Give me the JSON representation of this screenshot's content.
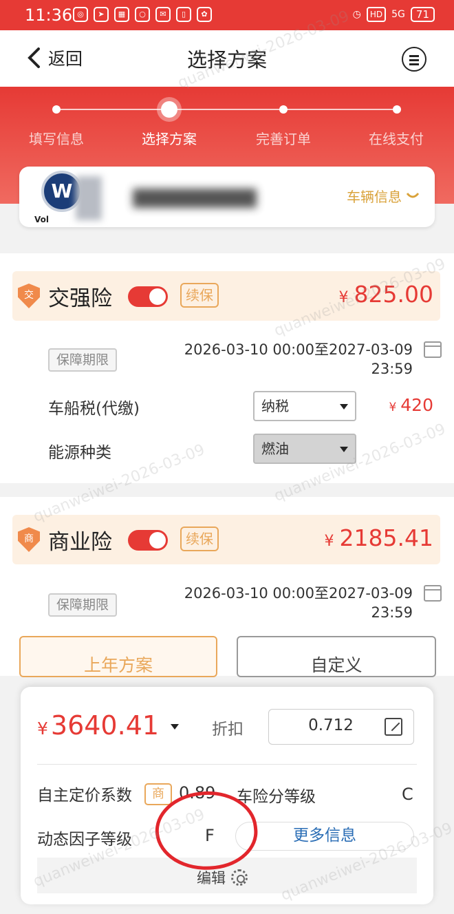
{
  "status_bar": {
    "time": "11:36",
    "network": "5G",
    "battery": "71",
    "hd": "HD",
    "app_icons": [
      "chat-icon",
      "send-icon",
      "app-icon",
      "message-icon",
      "mail-icon",
      "book-icon",
      "shop-icon"
    ]
  },
  "header": {
    "back_label": "返回",
    "title": "选择方案"
  },
  "steps": [
    {
      "label": "填写信息",
      "active": false
    },
    {
      "label": "选择方案",
      "active": true
    },
    {
      "label": "完善订单",
      "active": false
    },
    {
      "label": "在线支付",
      "active": false
    }
  ],
  "vehicle": {
    "brand_text": "Vol",
    "info_label": "车辆信息"
  },
  "compulsory": {
    "title": "交强险",
    "badge": "交",
    "renew_label": "续保",
    "price_currency": "¥",
    "price": "825.00",
    "period_tag": "保障期限",
    "period_line1": "2026-03-10 00:00至2027-03-09",
    "period_line2": "23:59",
    "tax_label": "车船税(代缴)",
    "tax_option": "纳税",
    "tax_currency": "¥",
    "tax_value": "420",
    "energy_label": "能源种类",
    "energy_option": "燃油",
    "toggle_on": true
  },
  "commercial": {
    "title": "商业险",
    "badge": "商",
    "renew_label": "续保",
    "price_currency": "¥",
    "price": "2185.41",
    "period_tag": "保障期限",
    "period_line1": "2026-03-10 00:00至2027-03-09",
    "period_line2": "23:59",
    "toggle_on": true
  },
  "plan_tabs": {
    "last_year": "上年方案",
    "custom": "自定义"
  },
  "summary": {
    "total_currency": "¥",
    "total": "3640.41",
    "discount_label": "折扣",
    "discount_value": "0.712",
    "pricing_label": "自主定价系数",
    "pricing_badge": "商",
    "pricing_value": "0.89",
    "grade_label": "车险分等级",
    "grade_value": "C",
    "dynamic_label": "动态因子等级",
    "dynamic_value": "F",
    "more_label": "更多信息",
    "edit_label": "编辑"
  },
  "watermark": "quanweiwei-2026-03-09",
  "colors": {
    "primary_red": "#e63a35",
    "accent_gold": "#e9a75a",
    "link_blue": "#2a6db5"
  }
}
